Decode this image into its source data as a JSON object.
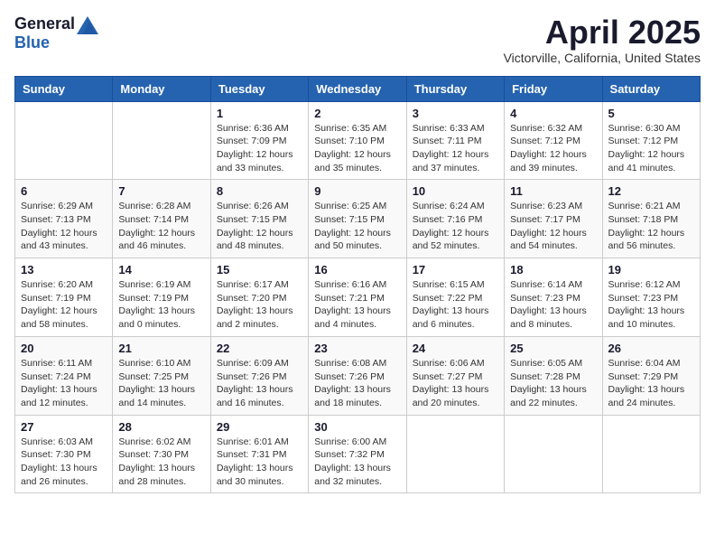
{
  "logo": {
    "general": "General",
    "blue": "Blue"
  },
  "title": "April 2025",
  "location": "Victorville, California, United States",
  "headers": [
    "Sunday",
    "Monday",
    "Tuesday",
    "Wednesday",
    "Thursday",
    "Friday",
    "Saturday"
  ],
  "weeks": [
    [
      {
        "day": "",
        "info": ""
      },
      {
        "day": "",
        "info": ""
      },
      {
        "day": "1",
        "info": "Sunrise: 6:36 AM\nSunset: 7:09 PM\nDaylight: 12 hours\nand 33 minutes."
      },
      {
        "day": "2",
        "info": "Sunrise: 6:35 AM\nSunset: 7:10 PM\nDaylight: 12 hours\nand 35 minutes."
      },
      {
        "day": "3",
        "info": "Sunrise: 6:33 AM\nSunset: 7:11 PM\nDaylight: 12 hours\nand 37 minutes."
      },
      {
        "day": "4",
        "info": "Sunrise: 6:32 AM\nSunset: 7:12 PM\nDaylight: 12 hours\nand 39 minutes."
      },
      {
        "day": "5",
        "info": "Sunrise: 6:30 AM\nSunset: 7:12 PM\nDaylight: 12 hours\nand 41 minutes."
      }
    ],
    [
      {
        "day": "6",
        "info": "Sunrise: 6:29 AM\nSunset: 7:13 PM\nDaylight: 12 hours\nand 43 minutes."
      },
      {
        "day": "7",
        "info": "Sunrise: 6:28 AM\nSunset: 7:14 PM\nDaylight: 12 hours\nand 46 minutes."
      },
      {
        "day": "8",
        "info": "Sunrise: 6:26 AM\nSunset: 7:15 PM\nDaylight: 12 hours\nand 48 minutes."
      },
      {
        "day": "9",
        "info": "Sunrise: 6:25 AM\nSunset: 7:15 PM\nDaylight: 12 hours\nand 50 minutes."
      },
      {
        "day": "10",
        "info": "Sunrise: 6:24 AM\nSunset: 7:16 PM\nDaylight: 12 hours\nand 52 minutes."
      },
      {
        "day": "11",
        "info": "Sunrise: 6:23 AM\nSunset: 7:17 PM\nDaylight: 12 hours\nand 54 minutes."
      },
      {
        "day": "12",
        "info": "Sunrise: 6:21 AM\nSunset: 7:18 PM\nDaylight: 12 hours\nand 56 minutes."
      }
    ],
    [
      {
        "day": "13",
        "info": "Sunrise: 6:20 AM\nSunset: 7:19 PM\nDaylight: 12 hours\nand 58 minutes."
      },
      {
        "day": "14",
        "info": "Sunrise: 6:19 AM\nSunset: 7:19 PM\nDaylight: 13 hours\nand 0 minutes."
      },
      {
        "day": "15",
        "info": "Sunrise: 6:17 AM\nSunset: 7:20 PM\nDaylight: 13 hours\nand 2 minutes."
      },
      {
        "day": "16",
        "info": "Sunrise: 6:16 AM\nSunset: 7:21 PM\nDaylight: 13 hours\nand 4 minutes."
      },
      {
        "day": "17",
        "info": "Sunrise: 6:15 AM\nSunset: 7:22 PM\nDaylight: 13 hours\nand 6 minutes."
      },
      {
        "day": "18",
        "info": "Sunrise: 6:14 AM\nSunset: 7:23 PM\nDaylight: 13 hours\nand 8 minutes."
      },
      {
        "day": "19",
        "info": "Sunrise: 6:12 AM\nSunset: 7:23 PM\nDaylight: 13 hours\nand 10 minutes."
      }
    ],
    [
      {
        "day": "20",
        "info": "Sunrise: 6:11 AM\nSunset: 7:24 PM\nDaylight: 13 hours\nand 12 minutes."
      },
      {
        "day": "21",
        "info": "Sunrise: 6:10 AM\nSunset: 7:25 PM\nDaylight: 13 hours\nand 14 minutes."
      },
      {
        "day": "22",
        "info": "Sunrise: 6:09 AM\nSunset: 7:26 PM\nDaylight: 13 hours\nand 16 minutes."
      },
      {
        "day": "23",
        "info": "Sunrise: 6:08 AM\nSunset: 7:26 PM\nDaylight: 13 hours\nand 18 minutes."
      },
      {
        "day": "24",
        "info": "Sunrise: 6:06 AM\nSunset: 7:27 PM\nDaylight: 13 hours\nand 20 minutes."
      },
      {
        "day": "25",
        "info": "Sunrise: 6:05 AM\nSunset: 7:28 PM\nDaylight: 13 hours\nand 22 minutes."
      },
      {
        "day": "26",
        "info": "Sunrise: 6:04 AM\nSunset: 7:29 PM\nDaylight: 13 hours\nand 24 minutes."
      }
    ],
    [
      {
        "day": "27",
        "info": "Sunrise: 6:03 AM\nSunset: 7:30 PM\nDaylight: 13 hours\nand 26 minutes."
      },
      {
        "day": "28",
        "info": "Sunrise: 6:02 AM\nSunset: 7:30 PM\nDaylight: 13 hours\nand 28 minutes."
      },
      {
        "day": "29",
        "info": "Sunrise: 6:01 AM\nSunset: 7:31 PM\nDaylight: 13 hours\nand 30 minutes."
      },
      {
        "day": "30",
        "info": "Sunrise: 6:00 AM\nSunset: 7:32 PM\nDaylight: 13 hours\nand 32 minutes."
      },
      {
        "day": "",
        "info": ""
      },
      {
        "day": "",
        "info": ""
      },
      {
        "day": "",
        "info": ""
      }
    ]
  ]
}
